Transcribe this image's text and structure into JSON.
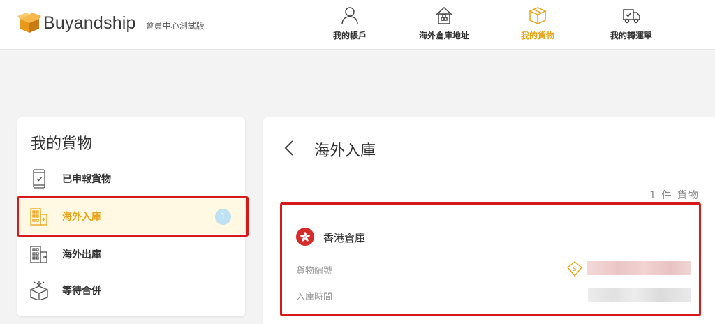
{
  "header": {
    "brand": "Buyandship",
    "subtitle": "會員中心測試版",
    "nav": [
      {
        "label": "我的帳戶",
        "icon": "user-icon"
      },
      {
        "label": "海外倉庫地址",
        "icon": "house-icon"
      },
      {
        "label": "我的貨物",
        "icon": "package-icon",
        "active": true
      },
      {
        "label": "我的轉運單",
        "icon": "delivery-truck-icon"
      }
    ]
  },
  "sidebar": {
    "title": "我的貨物",
    "items": [
      {
        "label": "已申報貨物",
        "icon": "phone-check-icon"
      },
      {
        "label": "海外入庫",
        "icon": "warehouse-in-icon",
        "active": true,
        "badge": "1"
      },
      {
        "label": "海外出庫",
        "icon": "warehouse-out-icon"
      },
      {
        "label": "等待合併",
        "icon": "box-merge-icon"
      }
    ]
  },
  "main": {
    "title": "海外入庫",
    "count": "1 件 貨物",
    "card": {
      "warehouse": "香港倉庫",
      "fields": [
        {
          "label": "貨物編號"
        },
        {
          "label": "入庫時間"
        }
      ]
    }
  },
  "colors": {
    "accent": "#e8a317",
    "highlight_border": "#d61a1a",
    "badge": "#bfe1f4",
    "flag": "#d52b2b"
  }
}
